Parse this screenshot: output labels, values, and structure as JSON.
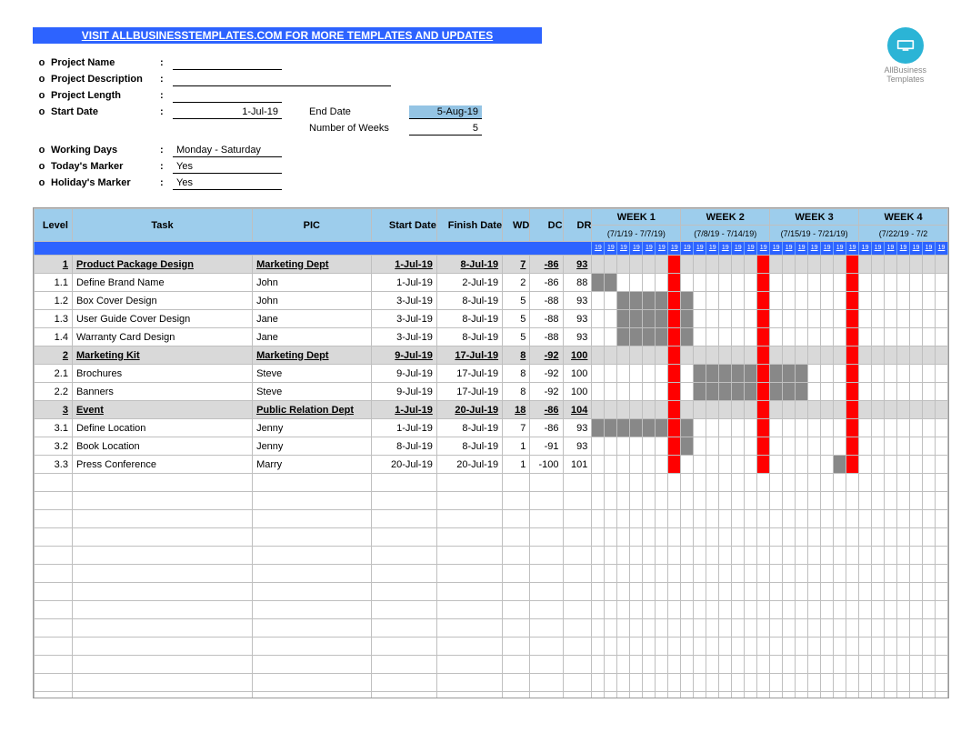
{
  "banner_text": "VISIT ALLBUSINESSTEMPLATES.COM FOR MORE TEMPLATES AND UPDATES",
  "logo_caption_line1": "AllBusiness",
  "logo_caption_line2": "Templates",
  "info": {
    "project_name_label": "Project Name",
    "project_name_value": "",
    "project_desc_label": "Project Description",
    "project_desc_value": "",
    "project_length_label": "Project Length",
    "project_length_value": "",
    "start_date_label": "Start Date",
    "start_date_value": "1-Jul-19",
    "end_date_label": "End Date",
    "end_date_value": "5-Aug-19",
    "num_weeks_label": "Number of Weeks",
    "num_weeks_value": "5",
    "working_days_label": "Working Days",
    "working_days_value": "Monday - Saturday",
    "todays_marker_label": "Today's Marker",
    "todays_marker_value": "Yes",
    "holidays_marker_label": "Holiday's Marker",
    "holidays_marker_value": "Yes"
  },
  "headers": {
    "level": "Level",
    "task": "Task",
    "pic": "PIC",
    "start": "Start Date",
    "finish": "Finish Date",
    "wd": "WD",
    "dc": "DC",
    "dr": "DR"
  },
  "weeks": [
    {
      "label": "WEEK 1",
      "range": "(7/1/19 - 7/7/19)"
    },
    {
      "label": "WEEK 2",
      "range": "(7/8/19 - 7/14/19)"
    },
    {
      "label": "WEEK 3",
      "range": "(7/15/19 - 7/21/19)"
    },
    {
      "label": "WEEK 4",
      "range": "(7/22/19 - 7/2"
    }
  ],
  "day_label": "19",
  "rows": [
    {
      "level": "1",
      "task": "Product Package Design",
      "pic": "Marketing Dept",
      "start": "1-Jul-19",
      "finish": "8-Jul-19",
      "wd": "7",
      "dc": "-86",
      "dr": "93",
      "summary": true,
      "bar_start": 0,
      "bar_len": 0
    },
    {
      "level": "1.1",
      "task": "Define Brand Name",
      "pic": "John",
      "start": "1-Jul-19",
      "finish": "2-Jul-19",
      "wd": "2",
      "dc": "-86",
      "dr": "88",
      "summary": false,
      "bar_start": 0,
      "bar_len": 2
    },
    {
      "level": "1.2",
      "task": "Box Cover Design",
      "pic": "John",
      "start": "3-Jul-19",
      "finish": "8-Jul-19",
      "wd": "5",
      "dc": "-88",
      "dr": "93",
      "summary": false,
      "bar_start": 2,
      "bar_len": 6
    },
    {
      "level": "1.3",
      "task": "User Guide Cover Design",
      "pic": "Jane",
      "start": "3-Jul-19",
      "finish": "8-Jul-19",
      "wd": "5",
      "dc": "-88",
      "dr": "93",
      "summary": false,
      "bar_start": 2,
      "bar_len": 6
    },
    {
      "level": "1.4",
      "task": "Warranty Card Design",
      "pic": "Jane",
      "start": "3-Jul-19",
      "finish": "8-Jul-19",
      "wd": "5",
      "dc": "-88",
      "dr": "93",
      "summary": false,
      "bar_start": 2,
      "bar_len": 6
    },
    {
      "level": "2",
      "task": "Marketing Kit",
      "pic": "Marketing Dept",
      "start": "9-Jul-19",
      "finish": "17-Jul-19",
      "wd": "8",
      "dc": "-92",
      "dr": "100",
      "summary": true,
      "bar_start": 0,
      "bar_len": 0
    },
    {
      "level": "2.1",
      "task": "Brochures",
      "pic": "Steve",
      "start": "9-Jul-19",
      "finish": "17-Jul-19",
      "wd": "8",
      "dc": "-92",
      "dr": "100",
      "summary": false,
      "bar_start": 8,
      "bar_len": 9
    },
    {
      "level": "2.2",
      "task": "Banners",
      "pic": "Steve",
      "start": "9-Jul-19",
      "finish": "17-Jul-19",
      "wd": "8",
      "dc": "-92",
      "dr": "100",
      "summary": false,
      "bar_start": 8,
      "bar_len": 9
    },
    {
      "level": "3",
      "task": "Event",
      "pic": "Public Relation Dept",
      "start": "1-Jul-19",
      "finish": "20-Jul-19",
      "wd": "18",
      "dc": "-86",
      "dr": "104",
      "summary": true,
      "bar_start": 0,
      "bar_len": 0
    },
    {
      "level": "3.1",
      "task": "Define Location",
      "pic": "Jenny",
      "start": "1-Jul-19",
      "finish": "8-Jul-19",
      "wd": "7",
      "dc": "-86",
      "dr": "93",
      "summary": false,
      "bar_start": 0,
      "bar_len": 8
    },
    {
      "level": "3.2",
      "task": "Book Location",
      "pic": "Jenny",
      "start": "8-Jul-19",
      "finish": "8-Jul-19",
      "wd": "1",
      "dc": "-91",
      "dr": "93",
      "summary": false,
      "bar_start": 7,
      "bar_len": 1
    },
    {
      "level": "3.3",
      "task": "Press Conference",
      "pic": "Marry",
      "start": "20-Jul-19",
      "finish": "20-Jul-19",
      "wd": "1",
      "dc": "-100",
      "dr": "101",
      "summary": false,
      "bar_start": 19,
      "bar_len": 1
    }
  ],
  "empty_rows": 15,
  "days_per_week": 7,
  "total_days": 28,
  "marker_days": [
    6,
    13,
    20
  ]
}
